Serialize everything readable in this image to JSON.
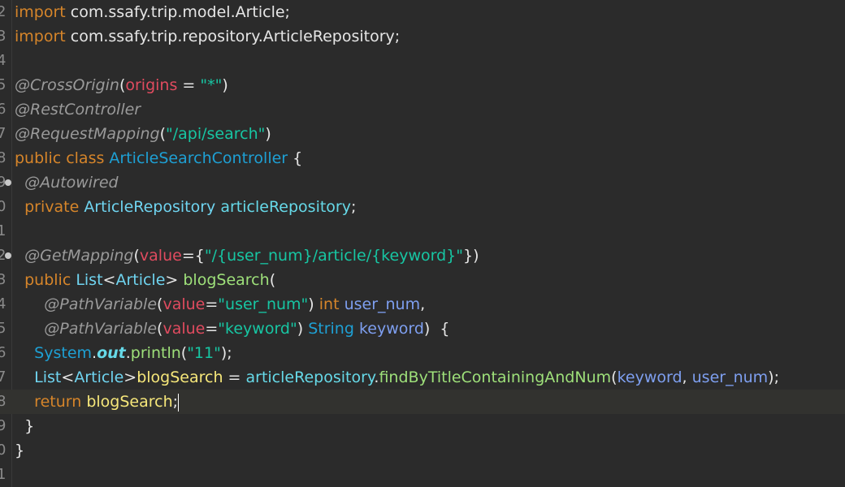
{
  "editor": {
    "lines": [
      {
        "num": "2",
        "fold": false,
        "current": false,
        "tokens": [
          {
            "t": "import",
            "c": "kw"
          },
          {
            "t": " com.ssafy.trip.model.Article;",
            "c": "plain"
          }
        ]
      },
      {
        "num": "3",
        "fold": false,
        "current": false,
        "tokens": [
          {
            "t": "import",
            "c": "kw"
          },
          {
            "t": " com.ssafy.trip.repository.ArticleRepository;",
            "c": "plain"
          }
        ]
      },
      {
        "num": "4",
        "fold": false,
        "current": false,
        "tokens": []
      },
      {
        "num": "5",
        "fold": false,
        "current": false,
        "tokens": [
          {
            "t": "@CrossOrigin",
            "c": "ann"
          },
          {
            "t": "(",
            "c": "plain"
          },
          {
            "t": "origins",
            "c": "attr"
          },
          {
            "t": " = ",
            "c": "plain"
          },
          {
            "t": "\"*\"",
            "c": "str"
          },
          {
            "t": ")",
            "c": "plain"
          }
        ]
      },
      {
        "num": "6",
        "fold": false,
        "current": false,
        "tokens": [
          {
            "t": "@RestController",
            "c": "ann"
          }
        ]
      },
      {
        "num": "7",
        "fold": false,
        "current": false,
        "tokens": [
          {
            "t": "@RequestMapping",
            "c": "ann"
          },
          {
            "t": "(",
            "c": "plain"
          },
          {
            "t": "\"/api/search\"",
            "c": "str"
          },
          {
            "t": ")",
            "c": "plain"
          }
        ]
      },
      {
        "num": "8",
        "fold": false,
        "current": false,
        "tokens": [
          {
            "t": "public class ",
            "c": "kw"
          },
          {
            "t": "ArticleSearchController",
            "c": "type"
          },
          {
            "t": " {",
            "c": "plain"
          }
        ]
      },
      {
        "num": "9",
        "fold": true,
        "current": false,
        "tokens": [
          {
            "t": "  ",
            "c": "plain"
          },
          {
            "t": "@Autowired",
            "c": "ann"
          }
        ]
      },
      {
        "num": "0",
        "fold": false,
        "current": false,
        "tokens": [
          {
            "t": "  ",
            "c": "plain"
          },
          {
            "t": "private ",
            "c": "kw"
          },
          {
            "t": "ArticleRepository",
            "c": "cls"
          },
          {
            "t": " ",
            "c": "plain"
          },
          {
            "t": "articleRepository",
            "c": "field"
          },
          {
            "t": ";",
            "c": "plain"
          }
        ]
      },
      {
        "num": "1",
        "fold": false,
        "current": false,
        "tokens": []
      },
      {
        "num": "2",
        "fold": true,
        "current": false,
        "tokens": [
          {
            "t": "  ",
            "c": "plain"
          },
          {
            "t": "@GetMapping",
            "c": "ann"
          },
          {
            "t": "(",
            "c": "plain"
          },
          {
            "t": "value",
            "c": "attr"
          },
          {
            "t": "={",
            "c": "plain"
          },
          {
            "t": "\"/{user_num}/article/{keyword}\"",
            "c": "str"
          },
          {
            "t": "})",
            "c": "plain"
          }
        ]
      },
      {
        "num": "3",
        "fold": false,
        "current": false,
        "tokens": [
          {
            "t": "  ",
            "c": "plain"
          },
          {
            "t": "public ",
            "c": "kw"
          },
          {
            "t": "List",
            "c": "cls"
          },
          {
            "t": "<",
            "c": "plain"
          },
          {
            "t": "Article",
            "c": "cls"
          },
          {
            "t": "> ",
            "c": "plain"
          },
          {
            "t": "blogSearch",
            "c": "method"
          },
          {
            "t": "(",
            "c": "plain"
          }
        ]
      },
      {
        "num": "4",
        "fold": false,
        "current": false,
        "tokens": [
          {
            "t": "      ",
            "c": "plain"
          },
          {
            "t": "@PathVariable",
            "c": "ann"
          },
          {
            "t": "(",
            "c": "plain"
          },
          {
            "t": "value",
            "c": "attr"
          },
          {
            "t": "=",
            "c": "plain"
          },
          {
            "t": "\"user_num\"",
            "c": "str"
          },
          {
            "t": ") ",
            "c": "plain"
          },
          {
            "t": "int",
            "c": "kw"
          },
          {
            "t": " ",
            "c": "plain"
          },
          {
            "t": "user_num",
            "c": "param"
          },
          {
            "t": ",",
            "c": "plain"
          }
        ]
      },
      {
        "num": "5",
        "fold": false,
        "current": false,
        "tokens": [
          {
            "t": "      ",
            "c": "plain"
          },
          {
            "t": "@PathVariable",
            "c": "ann"
          },
          {
            "t": "(",
            "c": "plain"
          },
          {
            "t": "value",
            "c": "attr"
          },
          {
            "t": "=",
            "c": "plain"
          },
          {
            "t": "\"keyword\"",
            "c": "str"
          },
          {
            "t": ") ",
            "c": "plain"
          },
          {
            "t": "String",
            "c": "type"
          },
          {
            "t": " ",
            "c": "plain"
          },
          {
            "t": "keyword",
            "c": "param"
          },
          {
            "t": ")  {",
            "c": "plain"
          }
        ]
      },
      {
        "num": "6",
        "fold": false,
        "current": false,
        "tokens": [
          {
            "t": "    ",
            "c": "plain"
          },
          {
            "t": "System",
            "c": "type"
          },
          {
            "t": ".",
            "c": "plain"
          },
          {
            "t": "out",
            "c": "field bi"
          },
          {
            "t": ".",
            "c": "plain"
          },
          {
            "t": "println",
            "c": "method"
          },
          {
            "t": "(",
            "c": "plain"
          },
          {
            "t": "\"11\"",
            "c": "str"
          },
          {
            "t": ");",
            "c": "plain"
          }
        ]
      },
      {
        "num": "7",
        "fold": false,
        "current": false,
        "tokens": [
          {
            "t": "    ",
            "c": "plain"
          },
          {
            "t": "List",
            "c": "cls"
          },
          {
            "t": "<",
            "c": "plain"
          },
          {
            "t": "Article",
            "c": "cls"
          },
          {
            "t": ">",
            "c": "plain"
          },
          {
            "t": "blogSearch",
            "c": "local"
          },
          {
            "t": " = ",
            "c": "plain"
          },
          {
            "t": "articleRepository",
            "c": "field"
          },
          {
            "t": ".",
            "c": "plain"
          },
          {
            "t": "findByTitleContainingAndNum",
            "c": "method"
          },
          {
            "t": "(",
            "c": "plain"
          },
          {
            "t": "keyword",
            "c": "param"
          },
          {
            "t": ", ",
            "c": "plain"
          },
          {
            "t": "user_num",
            "c": "param"
          },
          {
            "t": ");",
            "c": "plain"
          }
        ]
      },
      {
        "num": "8",
        "fold": false,
        "current": true,
        "tokens": [
          {
            "t": "    ",
            "c": "plain"
          },
          {
            "t": "return",
            "c": "kw"
          },
          {
            "t": " ",
            "c": "plain"
          },
          {
            "t": "blogSearch",
            "c": "local"
          },
          {
            "t": ";",
            "c": "plain"
          },
          {
            "t": "",
            "c": "caret"
          }
        ]
      },
      {
        "num": "9",
        "fold": false,
        "current": false,
        "tokens": [
          {
            "t": "  }",
            "c": "plain"
          }
        ]
      },
      {
        "num": "0",
        "fold": false,
        "current": false,
        "tokens": [
          {
            "t": "}",
            "c": "plain"
          }
        ]
      },
      {
        "num": "1",
        "fold": false,
        "current": false,
        "tokens": []
      }
    ]
  }
}
